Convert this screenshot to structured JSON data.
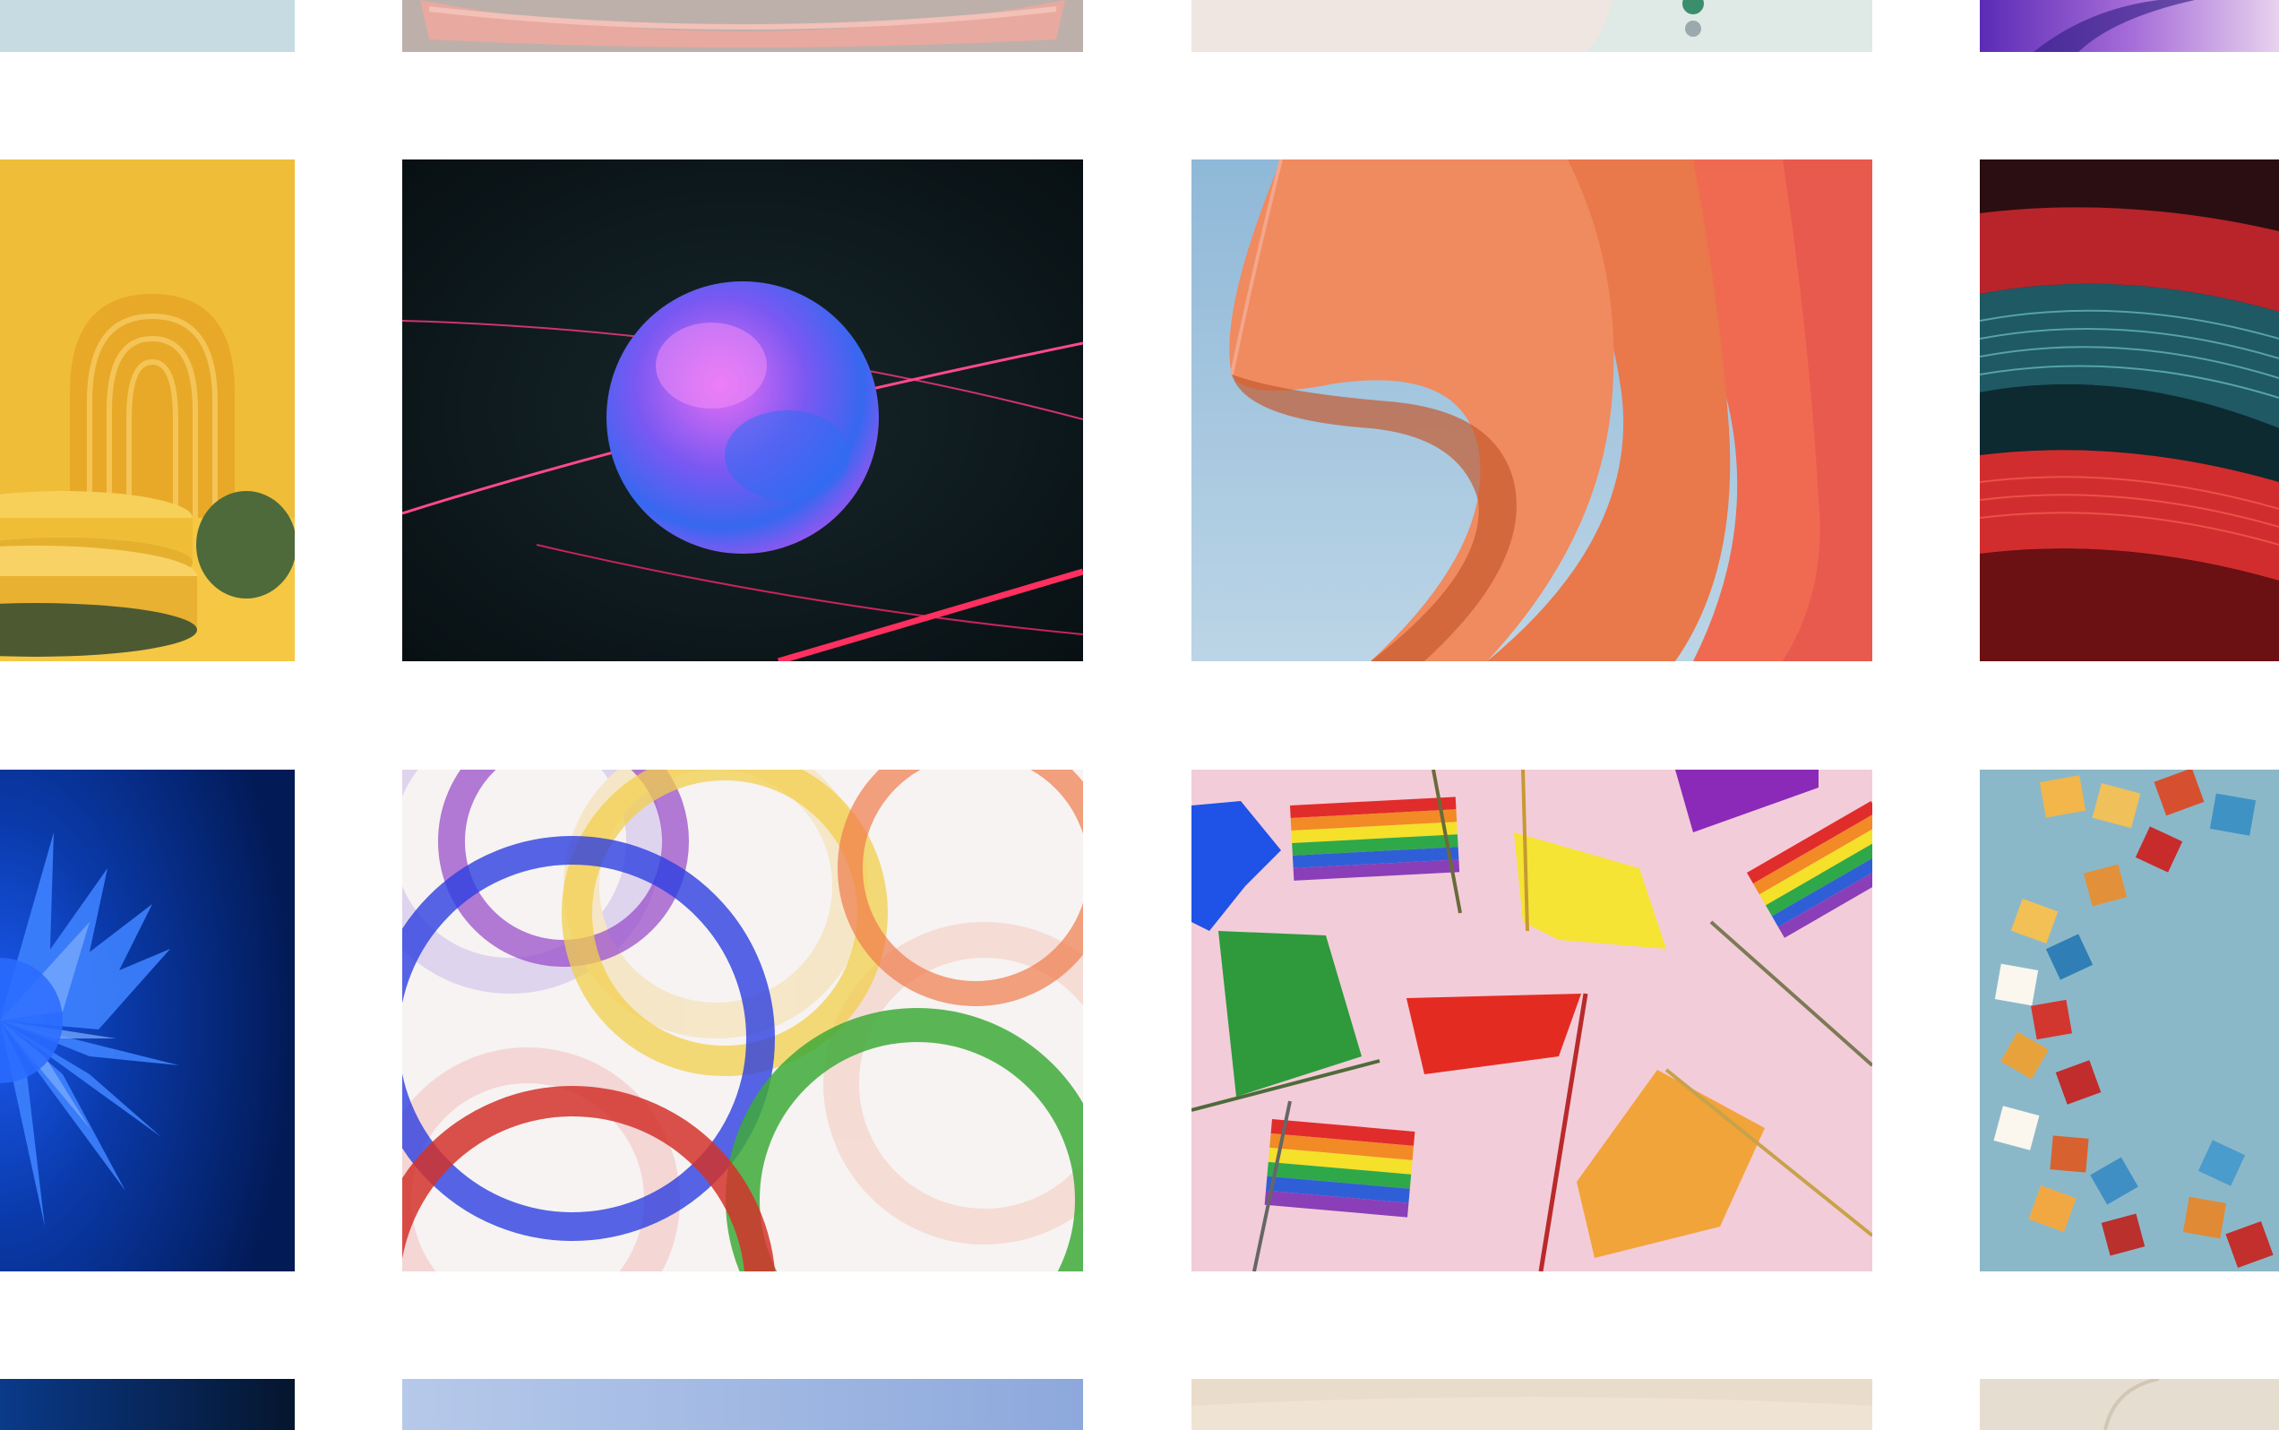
{
  "gallery": {
    "tiles": [
      {
        "row": 0,
        "col": 0,
        "subject": "pale-blue-wallpaper"
      },
      {
        "row": 0,
        "col": 1,
        "subject": "pink-pedestal-wallpaper"
      },
      {
        "row": 0,
        "col": 2,
        "subject": "cream-marble-wallpaper"
      },
      {
        "row": 0,
        "col": 3,
        "subject": "purple-gradient-wallpaper"
      },
      {
        "row": 1,
        "col": 0,
        "subject": "yellow-arch-podium-wallpaper"
      },
      {
        "row": 1,
        "col": 1,
        "subject": "glowing-orb-laser-wallpaper"
      },
      {
        "row": 1,
        "col": 2,
        "subject": "orange-folded-ribbon-wallpaper"
      },
      {
        "row": 1,
        "col": 3,
        "subject": "red-teal-wave-wallpaper"
      },
      {
        "row": 2,
        "col": 0,
        "subject": "blue-flower-wallpaper"
      },
      {
        "row": 2,
        "col": 1,
        "subject": "glass-rings-wallpaper"
      },
      {
        "row": 2,
        "col": 2,
        "subject": "pride-flags-wallpaper"
      },
      {
        "row": 2,
        "col": 3,
        "subject": "color-tiles-swirl-wallpaper"
      },
      {
        "row": 3,
        "col": 0,
        "subject": "dark-blue-wallpaper"
      },
      {
        "row": 3,
        "col": 1,
        "subject": "sky-blue-wallpaper"
      },
      {
        "row": 3,
        "col": 2,
        "subject": "beige-wallpaper"
      },
      {
        "row": 3,
        "col": 3,
        "subject": "beige-arc-wallpaper"
      }
    ]
  },
  "colors": {
    "background": "#ffffff",
    "pale_blue": "#c9dde3",
    "yellow": "#f0bd38",
    "night": "#0d1518",
    "orb_magenta": "#d86af0",
    "orb_blue": "#3b63f0",
    "laser": "#ff2d6f",
    "ribbon_orange": "#e8774a",
    "sky": "#9fc4dc",
    "deep_blue": "#032a7a",
    "pink": "#f3ccd9",
    "teal": "#8bb8c9"
  }
}
